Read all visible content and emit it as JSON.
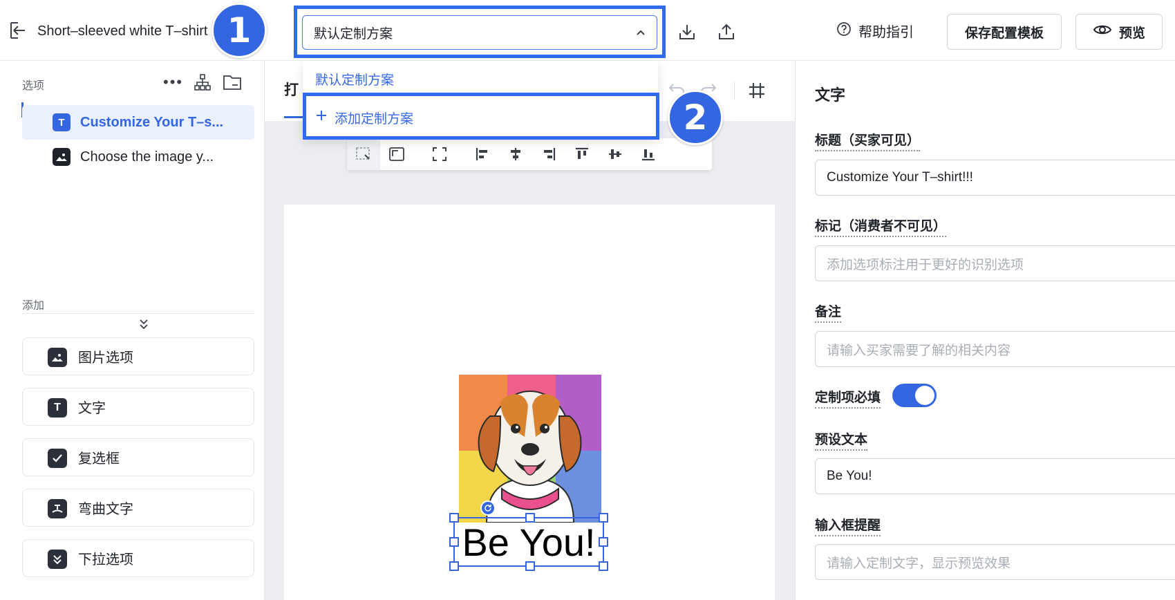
{
  "header": {
    "back_icon": "exit-icon",
    "product_title": "Short–sleeved white T–shirt",
    "scheme_select_value": "默认定制方案",
    "help_label": "帮助指引",
    "save_template_label": "保存配置模板",
    "preview_label": "预览"
  },
  "steps": {
    "step1": "1",
    "step2": "2"
  },
  "scheme_menu": {
    "items": [
      {
        "label": "默认定制方案"
      },
      {
        "label": "添加定制方案",
        "icon": "plus-icon"
      }
    ]
  },
  "sidebar": {
    "options_label": "选项",
    "options": [
      {
        "label": "Customize Your T–s...",
        "icon": "text-icon"
      },
      {
        "label": "Choose the image y...",
        "icon": "image-icon"
      }
    ],
    "add_label": "添加",
    "add_items": [
      {
        "label": "图片选项",
        "icon": "image-icon"
      },
      {
        "label": "文字",
        "icon": "text-icon"
      },
      {
        "label": "复选框",
        "icon": "checkbox-icon"
      },
      {
        "label": "弯曲文字",
        "icon": "curved-text-icon"
      },
      {
        "label": "下拉选项",
        "icon": "dropdown-icon"
      }
    ]
  },
  "canvas": {
    "tab_label": "打",
    "design_text": "Be You!"
  },
  "right_panel": {
    "heading": "文字",
    "title_label": "标题（买家可见）",
    "title_value": "Customize Your T–shirt!!!",
    "tag_label": "标记（消费者不可见）",
    "tag_placeholder": "添加选项标注用于更好的识别选项",
    "note_label": "备注",
    "note_placeholder": "请输入买家需要了解的相关内容",
    "required_label": "定制项必填",
    "required_on": true,
    "preset_label": "预设文本",
    "preset_value": "Be You!",
    "hint_label": "输入框提醒",
    "hint_placeholder": "请输入定制文字，显示预览效果"
  },
  "colors": {
    "accent": "#3366e0",
    "highlight": "#2f6bf0"
  }
}
